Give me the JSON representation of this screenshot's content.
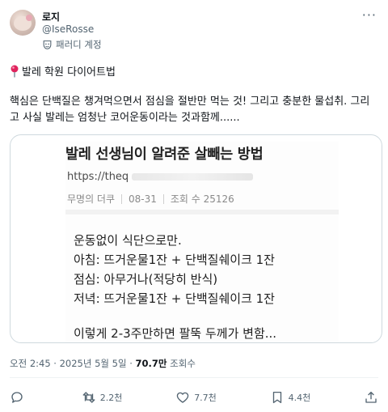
{
  "post": {
    "author_name": "로지",
    "handle": "@IseRosse",
    "parody_label": "패러디 계정",
    "more_icon": "more-dots-icon",
    "title": "발레 학원 다이어트법",
    "title_icon": "round-pushpin-icon",
    "body_line1": "핵심은 단백질은 챙겨먹으면서 점심을 절반만 먹는 것! 그리고 충분한 물섭취. 그리",
    "body_line2": "고 사실 발레는 엄청난 코어운동이라는 것과함께......"
  },
  "media": {
    "title": "발레 선생님이 알려준 살빼는 방법",
    "url": "https://theq",
    "source": "무명의 더쿠",
    "date": "08-31",
    "views": "조회 수 25126",
    "line1": "운동없이 식단으로만.",
    "line2": "아침: 뜨거운물1잔 + 단백질쉐이크 1잔",
    "line3": "점심: 아무거나(적당히 반식)",
    "line4": "저녁: 뜨거운물1잔 + 단백질쉐이크 1잔",
    "line5": "이렇게 2-3주만하면 팔뚝 두께가 변함..."
  },
  "meta": {
    "time": "오전 2:45 · 2025년 5월 5일 · ",
    "views_count": "70.7만",
    "views_label": " 조회수"
  },
  "actions": {
    "reply": {
      "icon": "reply-icon",
      "count": ""
    },
    "repost": {
      "icon": "repost-icon",
      "count": "2.2천"
    },
    "like": {
      "icon": "heart-icon",
      "count": "7.7천"
    },
    "bookmark": {
      "icon": "bookmark-icon",
      "count": "4.4천"
    },
    "share": {
      "icon": "share-icon",
      "count": ""
    }
  },
  "colors": {
    "text": "#0f1419",
    "secondary": "#536471",
    "border": "#cfd9de",
    "pin": "#e0245e"
  }
}
